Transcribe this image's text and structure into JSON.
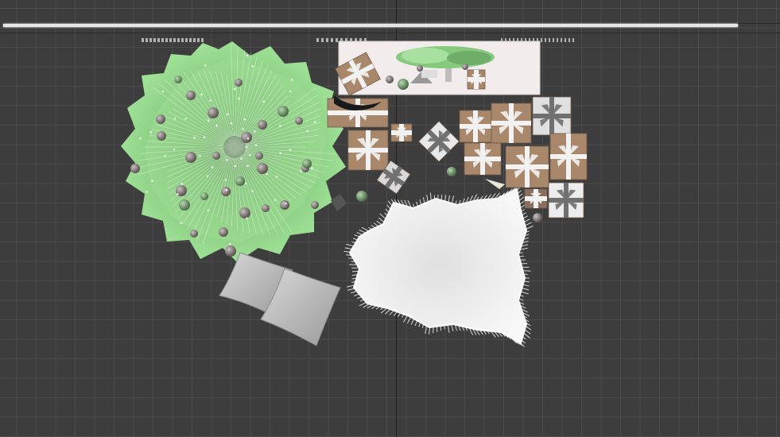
{
  "viewport": {
    "background": "#3d3d3d",
    "grid_color": "#4c4c4c",
    "axis_color": "#1e1e1e"
  },
  "scene": {
    "objects": [
      "christmas-tree",
      "ornaments",
      "gift-boxes",
      "fur-rug",
      "pillows",
      "window-bench",
      "garland"
    ],
    "colors": {
      "tree_green": "#8ed487",
      "gift_brown": "#a8876b",
      "ribbon_white": "#f2f2f2",
      "rug_white": "#ececec",
      "pillow_gray": "#c8c8c8",
      "bench_pink": "#f3ecec"
    }
  }
}
